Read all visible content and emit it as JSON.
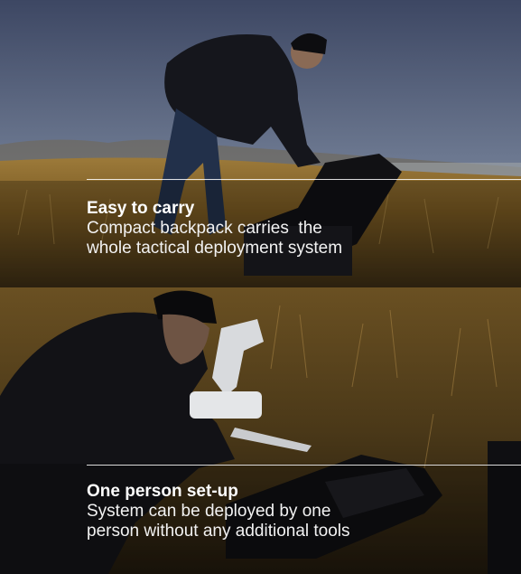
{
  "sections": [
    {
      "title": "Easy to carry",
      "description": "Compact backpack carries  the\nwhole tactical deployment system",
      "image": "person-opening-drone-backpack-photo"
    },
    {
      "title": "One person set-up",
      "description": "System can be deployed by one\nperson without any additional tools",
      "image": "person-assembling-drone-photo"
    }
  ],
  "colors": {
    "sky": "#5d6a82",
    "grass": "#8a6a2a",
    "text": "#ffffff"
  }
}
